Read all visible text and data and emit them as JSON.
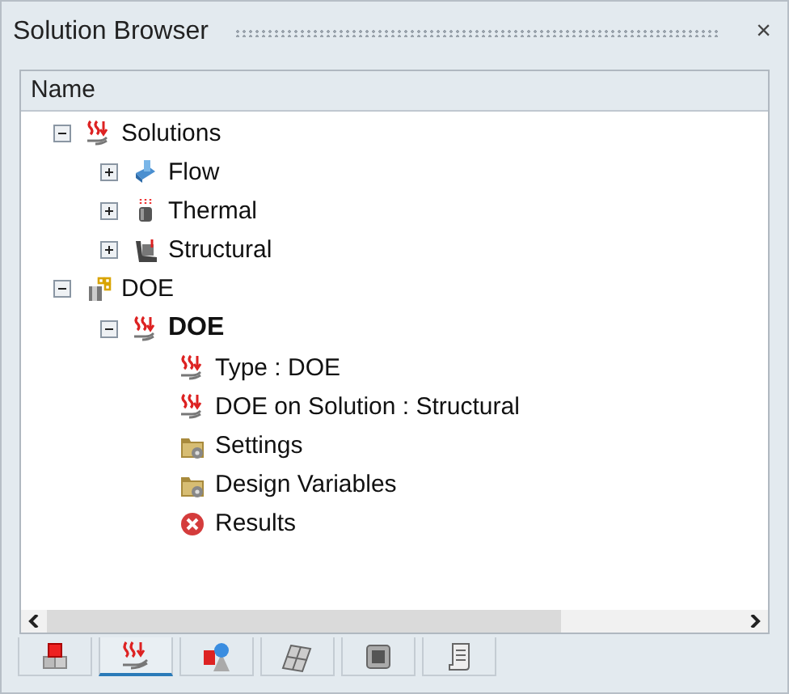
{
  "panel": {
    "title": "Solution Browser",
    "close": "×"
  },
  "tree": {
    "column": "Name",
    "nodes": [
      {
        "label": "Solutions",
        "kind": "solution",
        "expanded": true,
        "children": [
          {
            "label": "Flow",
            "kind": "flow",
            "expanded": false
          },
          {
            "label": "Thermal",
            "kind": "thermal",
            "expanded": false
          },
          {
            "label": "Structural",
            "kind": "structural",
            "expanded": false
          }
        ]
      },
      {
        "label": "DOE",
        "kind": "doe",
        "expanded": true,
        "children": [
          {
            "label": "DOE",
            "kind": "solution",
            "bold": true,
            "expanded": true,
            "children": [
              {
                "label": "Type : DOE",
                "kind": "solution"
              },
              {
                "label": "DOE on Solution : Structural",
                "kind": "solution"
              },
              {
                "label": "Settings",
                "kind": "folder"
              },
              {
                "label": "Design Variables",
                "kind": "folder"
              },
              {
                "label": "Results",
                "kind": "error"
              }
            ]
          }
        ]
      }
    ]
  },
  "tabs": [
    {
      "kind": "cubes",
      "selected": false
    },
    {
      "kind": "solution",
      "selected": true
    },
    {
      "kind": "shapes",
      "selected": false
    },
    {
      "kind": "plate",
      "selected": false
    },
    {
      "kind": "ai",
      "selected": false
    },
    {
      "kind": "scroll",
      "selected": false
    }
  ]
}
